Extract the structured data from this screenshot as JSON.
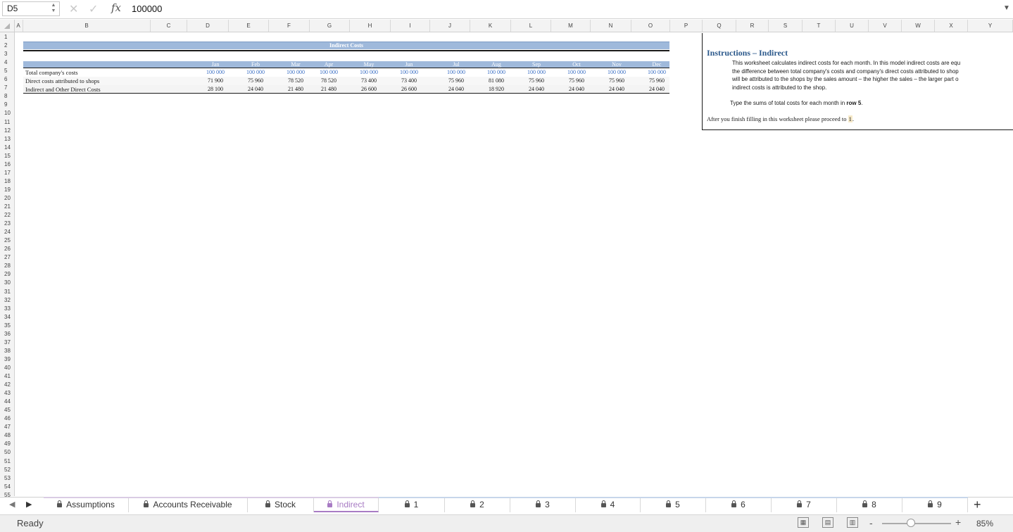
{
  "formula_bar": {
    "cell_ref": "D5",
    "cancel_icon": "close-icon",
    "confirm_icon": "check-icon",
    "fx_label": "fx",
    "value": "100000"
  },
  "columns": [
    "A",
    "B",
    "C",
    "D",
    "E",
    "F",
    "G",
    "H",
    "I",
    "J",
    "K",
    "L",
    "M",
    "N",
    "O",
    "P",
    "Q",
    "R",
    "S",
    "T",
    "U",
    "V",
    "W",
    "X",
    "Y"
  ],
  "rows": [
    "1",
    "2",
    "3",
    "4",
    "5",
    "6",
    "7",
    "8",
    "9",
    "10",
    "11",
    "12",
    "13",
    "14",
    "15",
    "16",
    "17",
    "18",
    "19",
    "20",
    "21",
    "22",
    "23",
    "24",
    "25",
    "26",
    "27",
    "28",
    "29",
    "30",
    "31",
    "32",
    "33",
    "34",
    "35",
    "36",
    "37",
    "38",
    "39",
    "40",
    "41",
    "42",
    "43",
    "44",
    "45",
    "46",
    "47",
    "48",
    "49",
    "50",
    "51",
    "52",
    "53",
    "54",
    "55"
  ],
  "table": {
    "title": "Indirect Costs",
    "months": [
      "Jan",
      "Feb",
      "Mar",
      "Apr",
      "May",
      "Jun",
      "Jul",
      "Aug",
      "Sep",
      "Oct",
      "Nov",
      "Dec"
    ],
    "rows": [
      {
        "label": "Total company's costs",
        "values": [
          "100 000",
          "100 000",
          "100 000",
          "100 000",
          "100 000",
          "100 000",
          "100 000",
          "100 000",
          "100 000",
          "100 000",
          "100 000",
          "100 000"
        ]
      },
      {
        "label": "Direct costs attributed to shops",
        "values": [
          "71 900",
          "75 960",
          "78 520",
          "78 520",
          "73 400",
          "73 400",
          "75 960",
          "81 080",
          "75 960",
          "75 960",
          "75 960",
          "75 960"
        ]
      },
      {
        "label": "Indirect and Other Direct Costs",
        "values": [
          "28 100",
          "24 040",
          "21 480",
          "21 480",
          "26 600",
          "26 600",
          "24 040",
          "18 920",
          "24 040",
          "24 040",
          "24 040",
          "24 040"
        ]
      }
    ]
  },
  "instructions": {
    "title": "Instructions – Indirect",
    "lines": [
      "This worksheet calculates indirect costs for each month. In this model indirect costs are equ",
      "the difference between total company's costs and company's direct costs attributed to shop",
      "will be attributed to the shops by the sales amount – the higher the sales – the larger part o",
      "indirect costs is attributed to the shop."
    ],
    "row5_prefix": "Type the sums of total costs for each month in ",
    "row5_bold": "row 5",
    "row5_suffix": ".",
    "proceed_prefix": "After you finish filling in this worksheet please proceed to ",
    "proceed_link": "1",
    "proceed_suffix": "."
  },
  "sheet_tabs": [
    {
      "label": "Assumptions",
      "active": false,
      "locked": true
    },
    {
      "label": "Accounts Receivable",
      "active": false,
      "locked": true
    },
    {
      "label": "Stock",
      "active": false,
      "locked": true
    },
    {
      "label": "Indirect",
      "active": true,
      "locked": true
    },
    {
      "label": "1",
      "active": false,
      "locked": true
    },
    {
      "label": "2",
      "active": false,
      "locked": true
    },
    {
      "label": "3",
      "active": false,
      "locked": true
    },
    {
      "label": "4",
      "active": false,
      "locked": true
    },
    {
      "label": "5",
      "active": false,
      "locked": true
    },
    {
      "label": "6",
      "active": false,
      "locked": true
    },
    {
      "label": "7",
      "active": false,
      "locked": true
    },
    {
      "label": "8",
      "active": false,
      "locked": true
    },
    {
      "label": "9",
      "active": false,
      "locked": true
    }
  ],
  "status": {
    "text": "Ready",
    "zoom": "85%",
    "zoom_minus": "-",
    "zoom_plus": "+",
    "add_sheet": "+"
  },
  "colors": {
    "accent_tab": "#a87bc4",
    "table_band": "#9fb9db",
    "input_blue": "#3a6fc4",
    "instr_title": "#2d5a8c"
  }
}
